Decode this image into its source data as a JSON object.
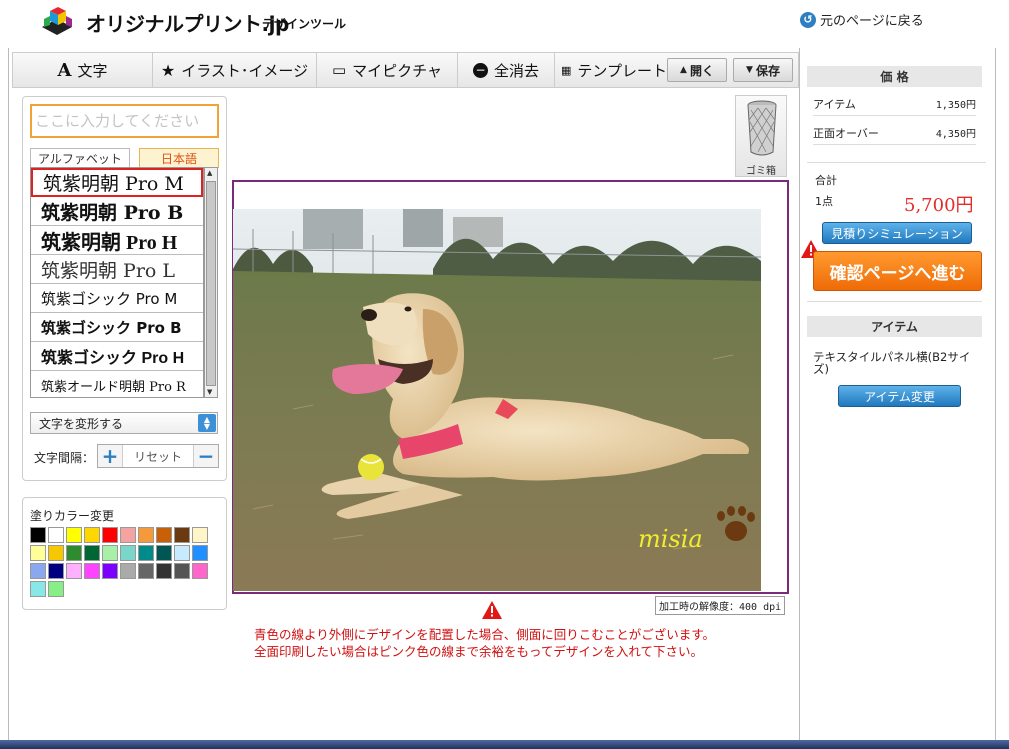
{
  "header": {
    "logo_text": "オリジナルプリント.jp",
    "subtitle": "デザインツール",
    "back_link": "元のページに戻る"
  },
  "toolbar": {
    "text": "文字",
    "illust": "イラスト･イメージ",
    "mypicture": "マイピクチャ",
    "clear": "全消去",
    "template": "テンプレート",
    "open": "開く",
    "save": "保存"
  },
  "text_panel": {
    "placeholder": "ここに入力してください",
    "tab_alphabet": "アルファベット",
    "tab_japanese": "日本語",
    "fonts": [
      "筑紫明朝 Pro M",
      "筑紫明朝 Pro B",
      "筑紫明朝 Pro H",
      "筑紫明朝 Pro L",
      "筑紫ゴシック Pro M",
      "筑紫ゴシック Pro B",
      "筑紫ゴシック Pro H",
      "筑紫オールド明朝 Pro R"
    ],
    "transform": "文字を変形する",
    "spacing_label": "文字間隔：",
    "reset": "リセット"
  },
  "color_panel": {
    "title": "塗りカラー変更",
    "colors": [
      "#000000",
      "#ffffff",
      "#ffff00",
      "#ffd700",
      "#ff0000",
      "#f4a3a3",
      "#f49a3a",
      "#c8600a",
      "#6b3a10",
      "#fff5c8",
      "#ffff99",
      "#f5c800",
      "#2e8b2e",
      "#006633",
      "#a8f0a8",
      "#7ad6c8",
      "#008b8b",
      "#005555",
      "#c8eaff",
      "#1e90ff",
      "#8aa8f0",
      "#000080",
      "#ffb0ff",
      "#ff44ff",
      "#7b00ff",
      "#aaaaaa",
      "#666666",
      "#333333",
      "#555555",
      "#ff66cc",
      "#88e8e8",
      "#88ee88"
    ]
  },
  "canvas": {
    "trash_label": "ゴミ箱",
    "resolution": "加工時の解像度：400 dpi",
    "signature": "misia",
    "warning_lines": [
      "青色の線より外側にデザインを配置した場合、側面に回りこむことがございます。",
      "全面印刷したい場合はピンク色の線まで余裕をもってデザインを入れて下さい。"
    ]
  },
  "price": {
    "head": "価 格",
    "rows": [
      {
        "label": "アイテム",
        "value": "1,350円"
      },
      {
        "label": "正面オーバー",
        "value": "4,350円"
      }
    ],
    "total_label": "合計",
    "count": "1点",
    "total": "5,700円",
    "estimate_button": "見積りシミュレーション",
    "confirm_button": "確認ページへ進む"
  },
  "item": {
    "head": "アイテム",
    "name": "テキスタイルパネル横(B2サイズ)",
    "change_button": "アイテム変更"
  }
}
